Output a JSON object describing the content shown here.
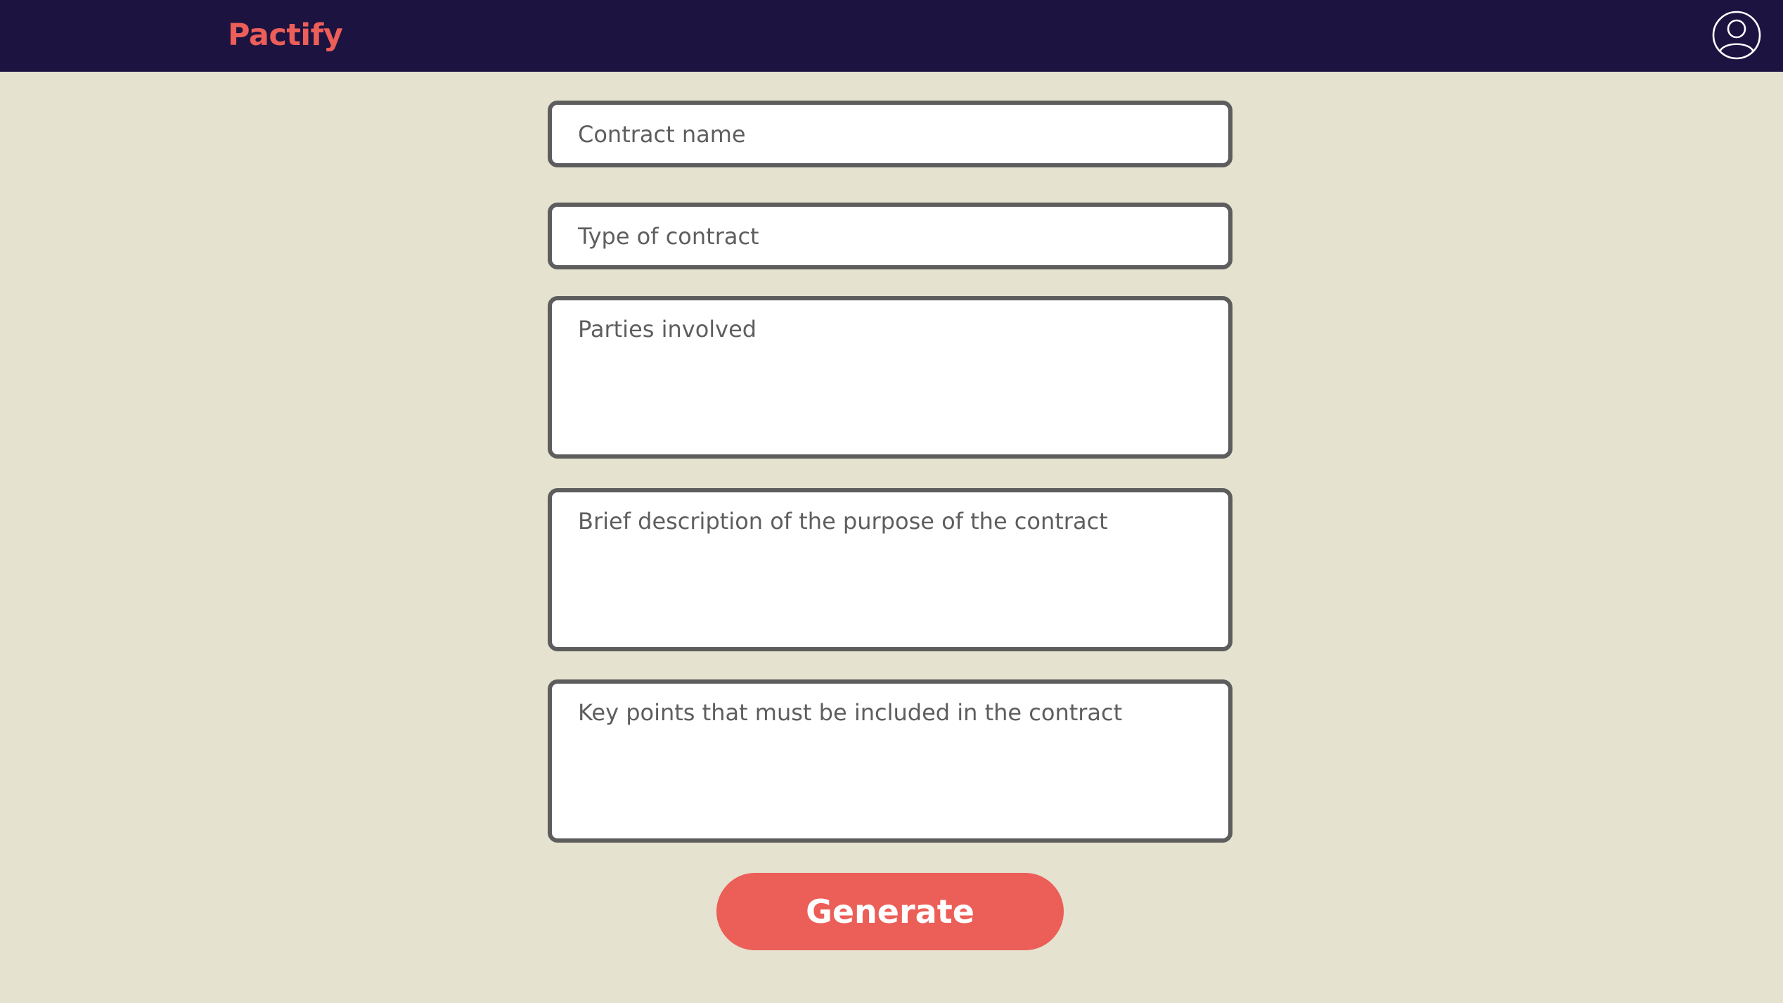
{
  "app": {
    "name": "Pactify",
    "brand_color": "#ec5e58",
    "header_color": "#1c1340",
    "background_color": "#e5e2cf"
  },
  "header": {
    "logo": "Pactify",
    "account_icon": "user-circle-icon"
  },
  "form": {
    "contract_name": {
      "placeholder": "Contract name",
      "value": ""
    },
    "contract_type": {
      "placeholder": "Type of contract",
      "value": ""
    },
    "parties": {
      "placeholder": "Parties involved",
      "value": ""
    },
    "description": {
      "placeholder": "Brief description of the purpose of the contract",
      "value": ""
    },
    "key_points": {
      "placeholder": "Key points that must be included in the contract",
      "value": ""
    },
    "submit_label": "Generate"
  }
}
